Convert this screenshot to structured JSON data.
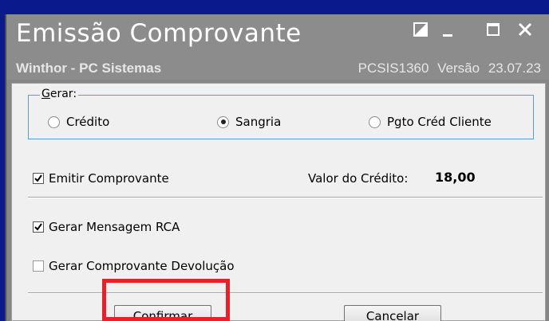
{
  "window": {
    "title": "Emissão Comprovante",
    "company": "Winthor - PC Sistemas",
    "routine_version": "PCSIS1360 Versão 23.07.23"
  },
  "group": {
    "legend_underlined": "G",
    "legend_rest": "erar:",
    "options": [
      {
        "label": "Crédito",
        "selected": false
      },
      {
        "label": "Sangria",
        "selected": true
      },
      {
        "label": "Pgto Créd Cliente",
        "selected": false
      }
    ]
  },
  "checks": {
    "emitir_label": "Emitir Comprovante",
    "emitir_checked": true,
    "mensagem_label": "Gerar Mensagem RCA",
    "mensagem_checked": true,
    "devolucao_label": "Gerar Comprovante Devolução",
    "devolucao_checked": false
  },
  "valor": {
    "label": "Valor do Crédito:",
    "value": "18,00"
  },
  "buttons": {
    "confirm_underlined": "C",
    "confirm_rest": "onfirmar",
    "cancel_pre": "C",
    "cancel_underlined": "a",
    "cancel_rest": "ncelar"
  },
  "colors": {
    "background": "#0a1a8c",
    "titlebar": "#8c8c8c",
    "highlight": "#e8202a",
    "group_border": "#5a9ad8"
  },
  "icons": [
    "restore-icon",
    "minimize-icon",
    "maximize-icon",
    "close-icon",
    "checkmark-icon"
  ]
}
